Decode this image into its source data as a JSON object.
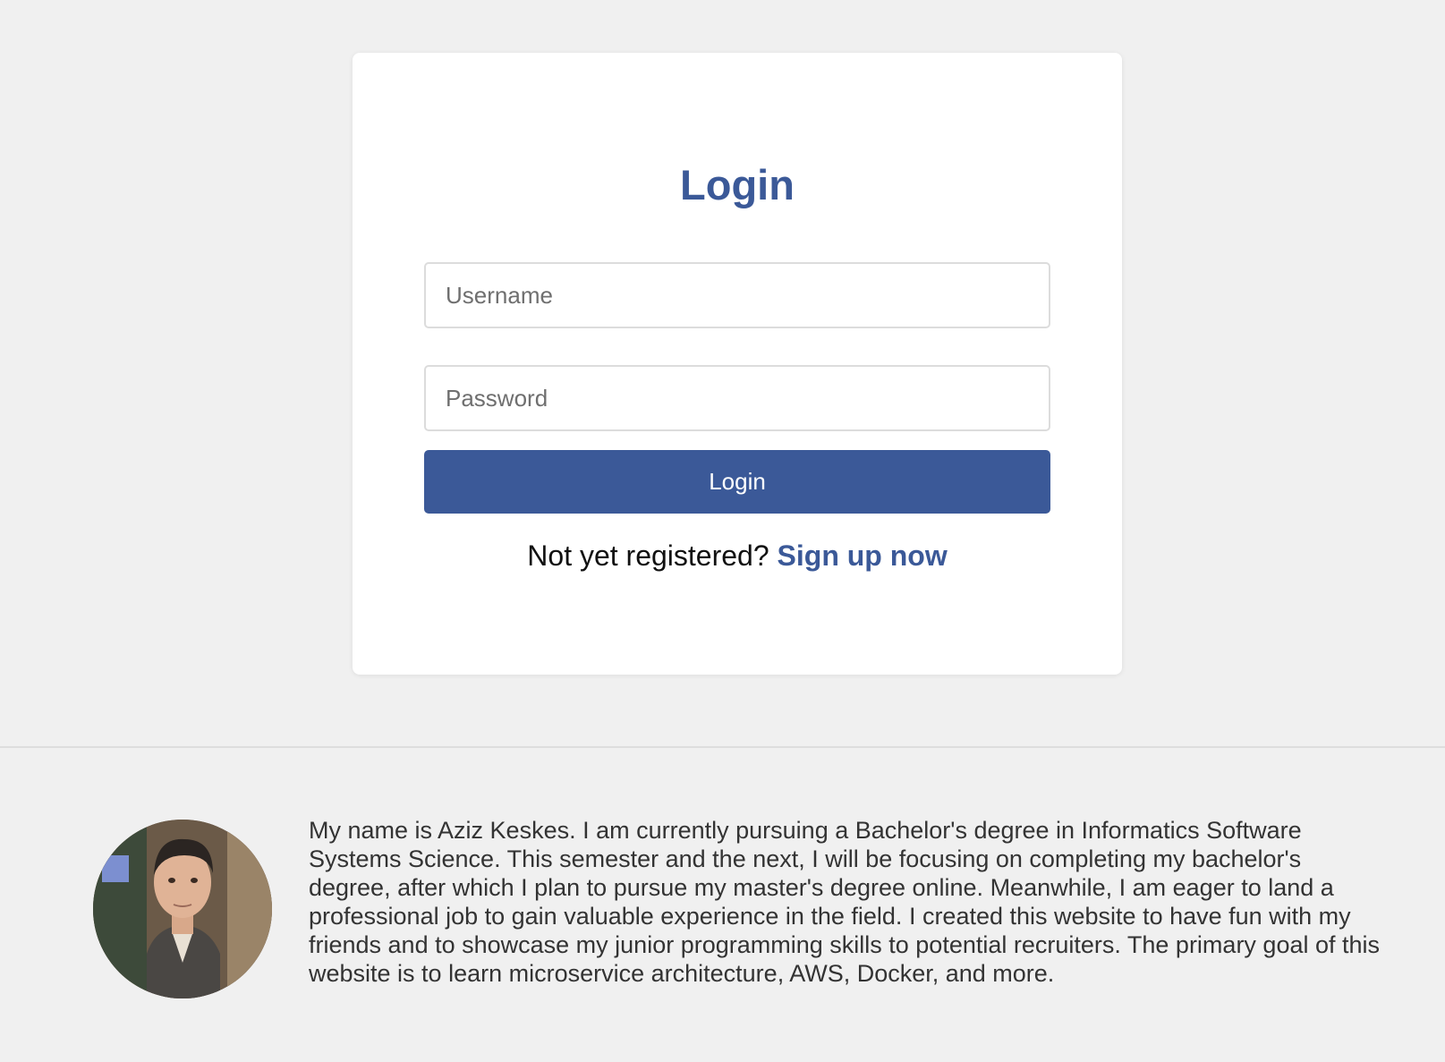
{
  "login": {
    "title": "Login",
    "username_placeholder": "Username",
    "password_placeholder": "Password",
    "button_label": "Login",
    "signup_prompt": "Not yet registered?",
    "signup_link": "Sign up now"
  },
  "about": {
    "bio": "My name is Aziz Keskes. I am currently pursuing a Bachelor's degree in Informatics Software Systems Science. This semester and the next, I will be focusing on completing my bachelor's degree, after which I plan to pursue my master's degree online. Meanwhile, I am eager to land a professional job to gain valuable experience in the field. I created this website to have fun with my friends and to showcase my junior programming skills to potential recruiters. The primary goal of this website is to learn microservice architecture, AWS, Docker, and more."
  },
  "colors": {
    "accent": "#3b5998",
    "background": "#f0f0f0",
    "card": "#ffffff"
  }
}
